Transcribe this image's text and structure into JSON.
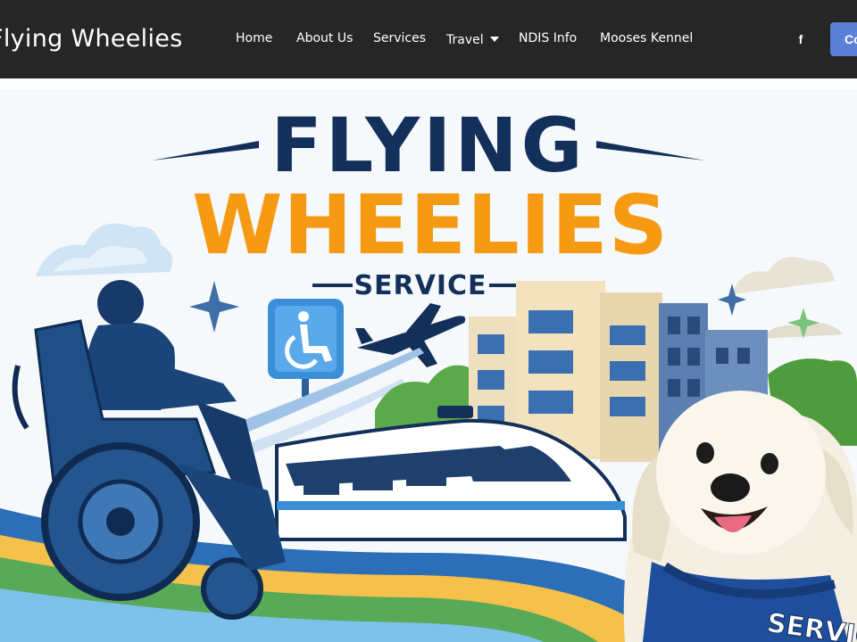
{
  "header": {
    "site_title": "Flying Wheelies",
    "nav": [
      {
        "label": "Home"
      },
      {
        "label": "About Us"
      },
      {
        "label": "Services"
      },
      {
        "label": "Travel",
        "has_dropdown": true
      },
      {
        "label": "NDIS Info"
      },
      {
        "label": "Mooses Kennel"
      }
    ],
    "social_icon": "facebook-icon",
    "social_glyph": "f",
    "cta_label": "Co"
  },
  "hero": {
    "logo_line1": "FLYING",
    "logo_line2": "WHEELIES",
    "logo_line3": "SERVICE",
    "vest_text": "SERVIC"
  },
  "colors": {
    "header_bg": "#262626",
    "cta_bg": "#5b7fd6",
    "logo_navy": "#13305a",
    "logo_orange": "#f59a12",
    "hero_bg": "#f6f9fc"
  }
}
